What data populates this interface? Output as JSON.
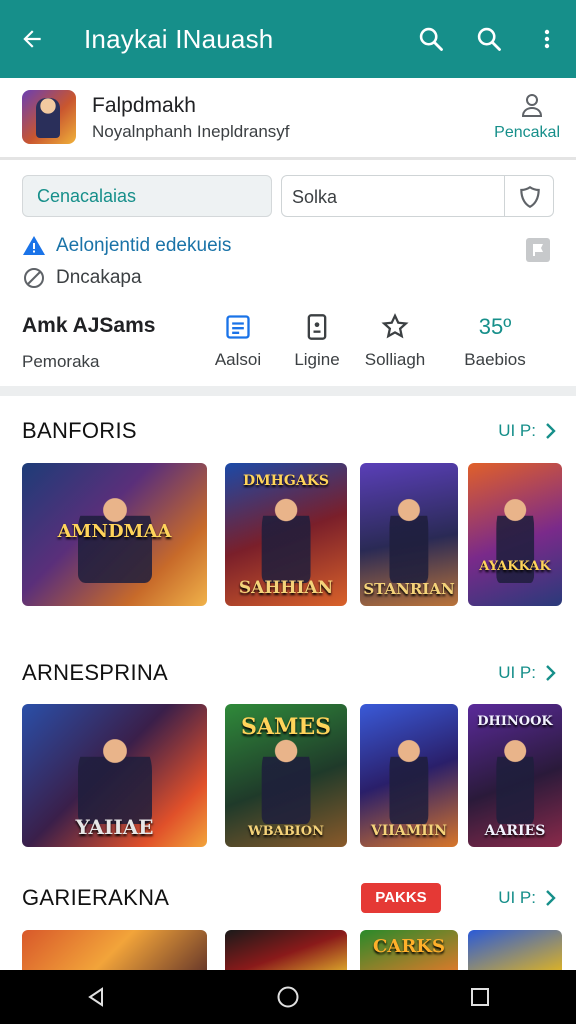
{
  "appbar": {
    "title": "Inaykai INauash",
    "icons": [
      "arrow-back-icon",
      "search-icon",
      "search-icon",
      "more-vert-icon"
    ]
  },
  "app": {
    "name": "Falpdmakh",
    "developer": "Noyalnphanh Inepldransyf",
    "person_caption": "Pencakal"
  },
  "actions": {
    "primary_label": "Cenacalaias",
    "field_value": "Solka"
  },
  "info": {
    "line1": "Aelonjentid edekueis",
    "line2": "Dncakapa"
  },
  "stats": {
    "main_value": "Amk AJSams",
    "main_label": "Pemoraka",
    "items": [
      {
        "label": "Aalsoi",
        "icon": "list-icon"
      },
      {
        "label": "Ligine",
        "icon": "phone-icon"
      },
      {
        "label": "Solliagh",
        "icon": "star-icon"
      },
      {
        "value": "35º",
        "label": "Baebios"
      }
    ]
  },
  "sections": [
    {
      "title": "BANFORIS",
      "more": "UI P:",
      "cards": [
        {
          "cap": "",
          "banner": "AMNDMAA"
        },
        {
          "cap": "SAHHIAN",
          "banner": "DMHGAKS"
        },
        {
          "cap": "STANRIAN",
          "banner": ""
        },
        {
          "cap": "",
          "banner": "AYAKKAK"
        }
      ]
    },
    {
      "title": "ARNESPRINA",
      "more": "UI P:",
      "cards": [
        {
          "cap": "YAIIAE",
          "banner": ""
        },
        {
          "cap": "WBABION",
          "banner": "SAMES"
        },
        {
          "cap": "VIIAMIIN",
          "banner": ""
        },
        {
          "cap": "AARIES",
          "banner": "DHINOOK"
        }
      ]
    },
    {
      "title": "GARIERAKNA",
      "more": "UI P:",
      "badge": "PAKKS",
      "cards": [
        {
          "cap": "",
          "banner": ""
        },
        {
          "cap": "",
          "banner": ""
        },
        {
          "cap": "",
          "banner": "CARKS"
        },
        {
          "cap": "",
          "banner": ""
        }
      ]
    }
  ],
  "colors": {
    "accent": "#168f8a",
    "badge": "#e53935"
  }
}
